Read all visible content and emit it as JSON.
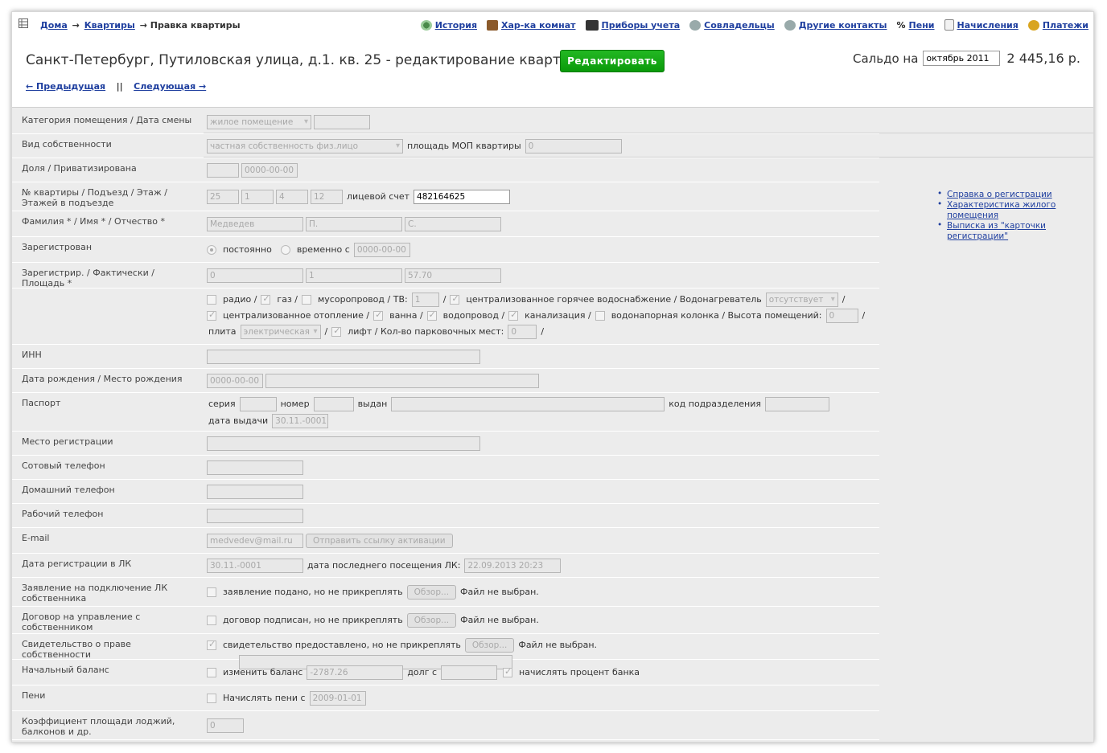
{
  "breadcrumb": {
    "home": "Дома",
    "flats": "Квартиры",
    "current": "Правка квартиры",
    "arrow": "→"
  },
  "toplinks": [
    {
      "label": "История",
      "icon": "history-icon"
    },
    {
      "label": "Хар-ка комнат",
      "icon": "room-icon"
    },
    {
      "label": "Приборы учета",
      "icon": "meter-icon"
    },
    {
      "label": "Совладельцы",
      "icon": "owners-icon"
    },
    {
      "label": "Другие контакты",
      "icon": "contacts-icon"
    },
    {
      "label": "Пени",
      "icon": "percent-icon",
      "prefix": "%"
    },
    {
      "label": "Начисления",
      "icon": "document-icon"
    },
    {
      "label": "Платежи",
      "icon": "coins-icon"
    }
  ],
  "title": "Санкт-Петербург, Путиловская улица, д.1. кв. 25 - редактирование квартиры",
  "edit_button": "Редактировать",
  "saldo": {
    "label": "Сальдо на",
    "period": "октябрь 2011",
    "amount": "2 445,16 р."
  },
  "nav": {
    "prev": "← Предыдущая",
    "separator": "||",
    "next": "Следующая →"
  },
  "side_links": [
    "Справка о регистрации",
    "Характеристика жилого помещения",
    "Выписка из \"карточки регистрации\""
  ],
  "rows": {
    "category": {
      "label": "Категория помещения / Дата смены",
      "value": "жилое помещение"
    },
    "ownership": {
      "label": "Вид собственности",
      "value": "частная собственность физ.лицо",
      "mop_label": "площадь МОП квартиры",
      "mop_value": "0"
    },
    "share": {
      "label": "Доля / Приватизирована",
      "date": "0000-00-00"
    },
    "flat": {
      "label": "№ квартиры / Подъезд / Этаж / Этажей в подъезде",
      "num": "25",
      "entrance": "1",
      "floor": "4",
      "floors": "12",
      "account_label": "лицевой счет",
      "account": "482164625"
    },
    "name": {
      "label": "Фамилия * / Имя * / Отчество *",
      "last": "Медведев",
      "first": "П.",
      "middle": "С."
    },
    "registered": {
      "label": "Зарегистрован",
      "permanent": "постоянно",
      "temporary": "временно с",
      "date": "0000-00-00"
    },
    "counts": {
      "label": "Зарегистрир. / Фактически / Площадь *",
      "reg": "0",
      "fact": "1",
      "area": "57.70"
    },
    "amenities": {
      "radio": "радио /",
      "gas": "газ /",
      "chute": "мусоропровод / ТВ:",
      "tv": "1",
      "slash": "/",
      "hotwater": "централизованное горячее водоснабжение / Водонагреватель",
      "heater": "отсутствует",
      "heating": "централизованное отопление /",
      "bath": "ванна /",
      "water": "водопровод /",
      "sewer": "канализация /",
      "column": "водонапорная колонка / Высота помещений:",
      "height": "0",
      "stove_label": "плита",
      "stove": "электрическая",
      "lift": "лифт / Кол-во парковочных мест:",
      "parking": "0"
    },
    "inn": {
      "label": "ИНН"
    },
    "birth": {
      "label": "Дата рождения / Место рождения",
      "date": "0000-00-00"
    },
    "passport": {
      "label": "Паспорт",
      "series": "серия",
      "number": "номер",
      "issued": "выдан",
      "code": "код подразделения",
      "date_label": "дата выдачи",
      "date": "30.11.-0001"
    },
    "reg_place": {
      "label": "Место регистрации"
    },
    "mobile": {
      "label": "Сотовый телефон"
    },
    "home_phone": {
      "label": "Домашний телефон"
    },
    "work_phone": {
      "label": "Рабочий телефон"
    },
    "email": {
      "label": "E-mail",
      "value": "medvedev@mail.ru",
      "button": "Отправить ссылку активации"
    },
    "lk_date": {
      "label": "Дата регистрации в ЛК",
      "value": "30.11.-0001",
      "last_label": "дата последнего посещения ЛК:",
      "last": "22.09.2013 20:23"
    },
    "lk_app": {
      "label": "Заявление на подключение ЛК собственника",
      "text": "заявление подано, но не прикреплять",
      "browse": "Обзор...",
      "file": "Файл не выбран."
    },
    "contract": {
      "label": "Договор на управление с собственником",
      "text": "договор подписан, но не прикреплять",
      "browse": "Обзор...",
      "file": "Файл не выбран."
    },
    "certificate": {
      "label": "Свидетельство о праве собственности",
      "text": "свидетельство предоставлено, но не прикреплять",
      "browse": "Обзор...",
      "file": "Файл не выбран."
    },
    "balance": {
      "label": "Начальный баланс",
      "change": "изменить баланс",
      "value": "-2787.26",
      "debt": "долг с",
      "percent": "начислять процент банка"
    },
    "penalty": {
      "label": "Пени",
      "text": "Начислять пени с",
      "date": "2009-01-01"
    },
    "coef": {
      "label": "Коэффициент площади лоджий, балконов и др.",
      "value": "0"
    }
  }
}
